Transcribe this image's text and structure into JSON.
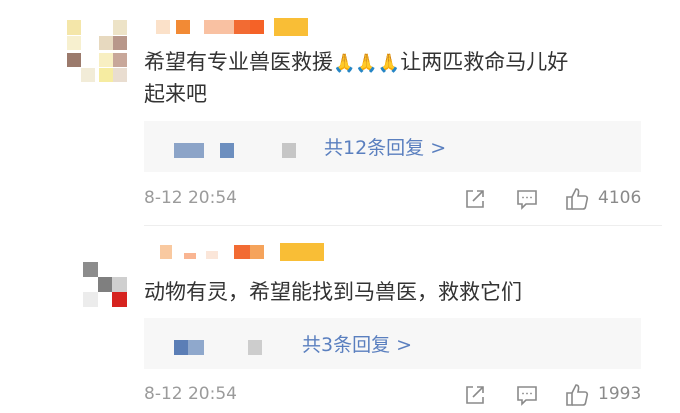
{
  "comments": [
    {
      "text": "希望有专业兽医救援",
      "emoji": "🙏🙏🙏",
      "text_after": "让两匹救命马儿好",
      "text_line2": "起来吧",
      "reply_summary": "共12条回复 >",
      "timestamp": "8-12 20:54",
      "like_count": "4106"
    },
    {
      "text": "动物有灵，希望能找到马兽医，救救它们",
      "reply_summary": "共3条回复 >",
      "timestamp": "8-12 20:54",
      "like_count": "1993"
    }
  ],
  "icons": {
    "share": "share-icon",
    "comment": "comment-icon",
    "like": "like-icon"
  },
  "colors": {
    "link": "#5a7fbf",
    "meta": "#9b9b9b",
    "reply_bg": "#f7f7f7"
  }
}
